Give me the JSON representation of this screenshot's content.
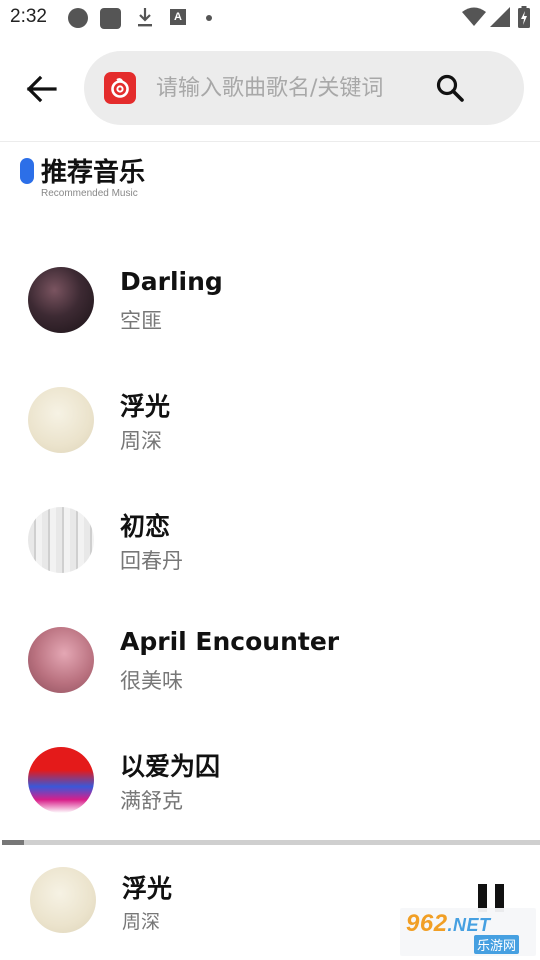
{
  "status_bar": {
    "time": "2:32",
    "icons": [
      "circle-icon",
      "square-icon",
      "download-icon",
      "font-a-icon",
      "dot-icon",
      "wifi-icon",
      "signal-icon",
      "battery-icon"
    ],
    "a_glyph": "A"
  },
  "header": {
    "back_icon": "arrow-left-icon",
    "logo_icon": "netease-music-logo",
    "search_placeholder": "请输入歌曲歌名/关键词",
    "search_icon": "search-icon"
  },
  "section": {
    "title": "推荐音乐",
    "subtitle": "Recommended Music",
    "accent_color": "#2c6fe8"
  },
  "songs": [
    {
      "title": "Darling",
      "artist": "空匪",
      "cover": "cover-dark"
    },
    {
      "title": "浮光",
      "artist": "周深",
      "cover": "cover-cream"
    },
    {
      "title": "初恋",
      "artist": "回春丹",
      "cover": "cover-gray"
    },
    {
      "title": "April Encounter",
      "artist": "很美味",
      "cover": "cover-pink"
    },
    {
      "title": "以爱为囚",
      "artist": "满舒克",
      "cover": "cover-red"
    }
  ],
  "player": {
    "title": "浮光",
    "artist": "周深",
    "progress": 0.04,
    "state_icon": "pause-icon"
  },
  "watermark": {
    "number": "962",
    "net": ".NET",
    "site": "乐游网"
  }
}
